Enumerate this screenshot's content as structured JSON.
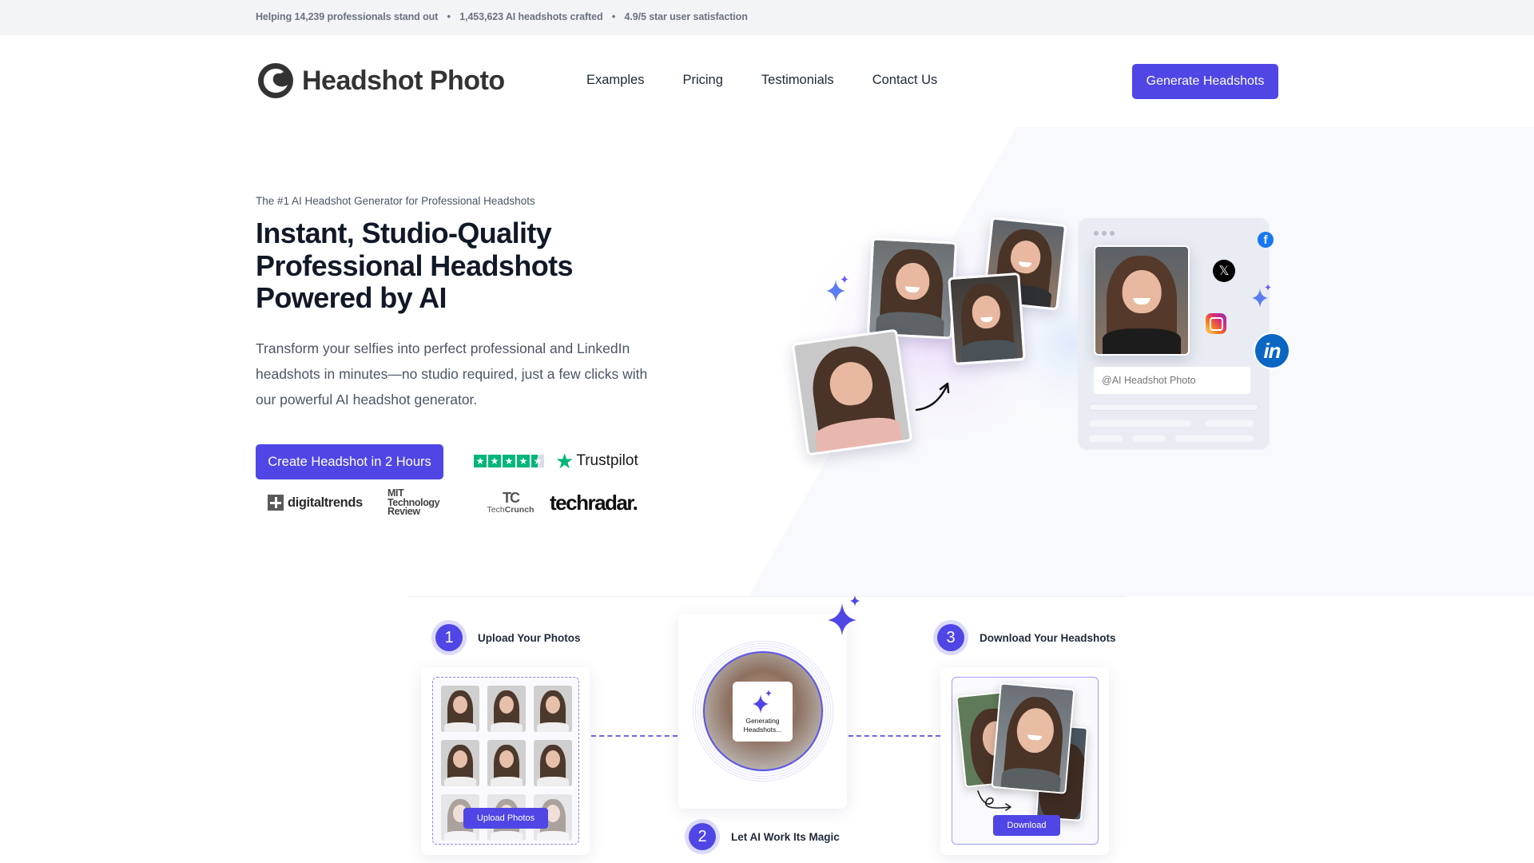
{
  "topbar": {
    "stats": [
      "Helping 14,239 professionals stand out",
      "1,453,623 AI headshots crafted",
      "4.9/5 star user satisfaction"
    ],
    "separator": "•"
  },
  "header": {
    "brand": "Headshot Photo",
    "nav": [
      "Examples",
      "Pricing",
      "Testimonials",
      "Contact Us"
    ],
    "cta_label": "Generate Headshots"
  },
  "hero": {
    "eyebrow": "The #1 AI Headshot Generator for Professional Headshots",
    "headline": "Instant, Studio-Quality Professional Headshots Powered by AI",
    "subtext": "Transform your selfies into perfect professional and LinkedIn headshots in minutes—no studio required, just a few clicks with our powerful AI headshot generator.",
    "cta_label": "Create Headshot in 2 Hours",
    "trustpilot": {
      "brand": "Trustpilot",
      "rating_stars": 4.5,
      "max_stars": 5
    },
    "press": {
      "digitaltrends": "digitaltrends",
      "mit": [
        "MIT",
        "Technology",
        "Review"
      ],
      "techcrunch_mark": "TC",
      "techcrunch_tech": "Tech",
      "techcrunch_crunch": "Crunch",
      "techradar": "techradar."
    },
    "illustration": {
      "handle_placeholder": "@AI Headshot Photo",
      "social_icons": [
        "facebook-icon",
        "x-icon",
        "instagram-icon",
        "linkedin-icon"
      ],
      "fb_glyph": "f",
      "x_glyph": "𝕏",
      "li_glyph": "in"
    }
  },
  "steps": [
    {
      "number": "1",
      "label": "Upload Your Photos",
      "button": "Upload Photos"
    },
    {
      "number": "2",
      "label": "Let AI Work Its Magic",
      "status_line1": "Generating",
      "status_line2": "Headshots..."
    },
    {
      "number": "3",
      "label": "Download Your Headshots",
      "button": "Download"
    }
  ],
  "colors": {
    "accent": "#4f46e5",
    "accent_soft": "#dcdafa",
    "trustpilot_green": "#00b67a",
    "topbar_bg": "#f3f4f6",
    "heading": "#111827",
    "body_text": "#4b5563"
  }
}
